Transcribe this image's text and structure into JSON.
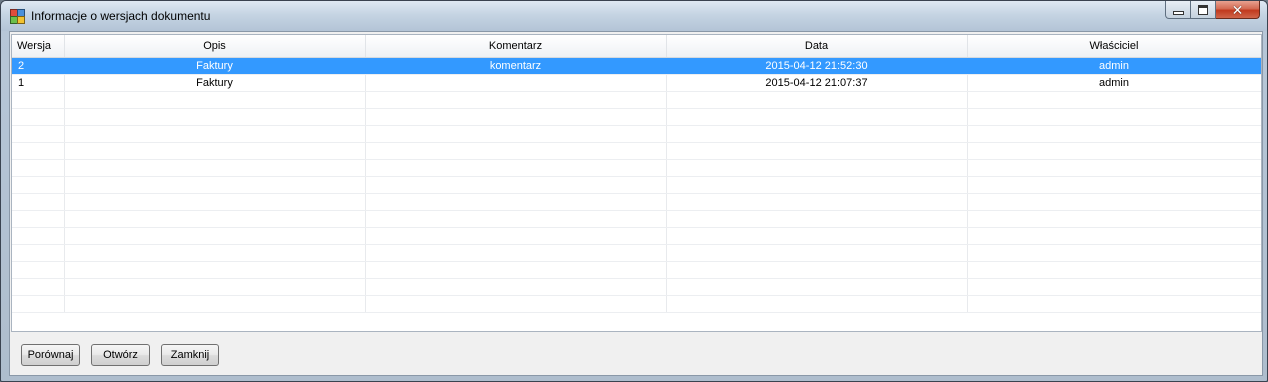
{
  "window": {
    "title": "Informacje o wersjach dokumentu",
    "minimize_label": "",
    "maximize_label": "",
    "close_symbol": "✕"
  },
  "grid": {
    "columns": [
      "Wersja",
      "Opis",
      "Komentarz",
      "Data",
      "Właściciel"
    ],
    "rows": [
      {
        "wersja": "2",
        "opis": "Faktury",
        "komentarz": "komentarz",
        "data": "2015-04-12 21:52:30",
        "wlasciciel": "admin",
        "selected": true
      },
      {
        "wersja": "1",
        "opis": "Faktury",
        "komentarz": "",
        "data": "2015-04-12 21:07:37",
        "wlasciciel": "admin",
        "selected": false
      }
    ],
    "selection_color": "#3399ff"
  },
  "buttons": {
    "compare": "Porównaj",
    "open": "Otwórz",
    "close": "Zamknij"
  }
}
